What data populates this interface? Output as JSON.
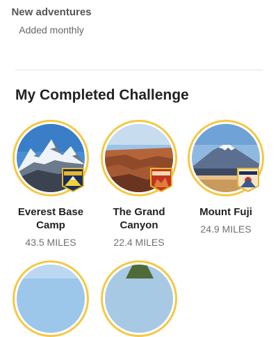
{
  "promo": {
    "title": "New adventures",
    "subtitle": "Added monthly"
  },
  "section": {
    "title": "My Completed Challenge"
  },
  "challenges": [
    {
      "name": "Everest Base Camp",
      "distance": "43.5 MILES",
      "badge_text": "EVEREST BASE CAMP",
      "photo": "snowy-mountains"
    },
    {
      "name": "The Grand Canyon",
      "distance": "22.4 MILES",
      "badge_text": "GRAND CANYON",
      "photo": "red-canyon"
    },
    {
      "name": "Mount Fuji",
      "distance": "24.9 MILES",
      "badge_text": "MOUNT FUJI",
      "photo": "volcano-lake"
    }
  ],
  "colors": {
    "ring": "#f5c842",
    "divider": "#e3e3e3",
    "distance": "#707070"
  }
}
